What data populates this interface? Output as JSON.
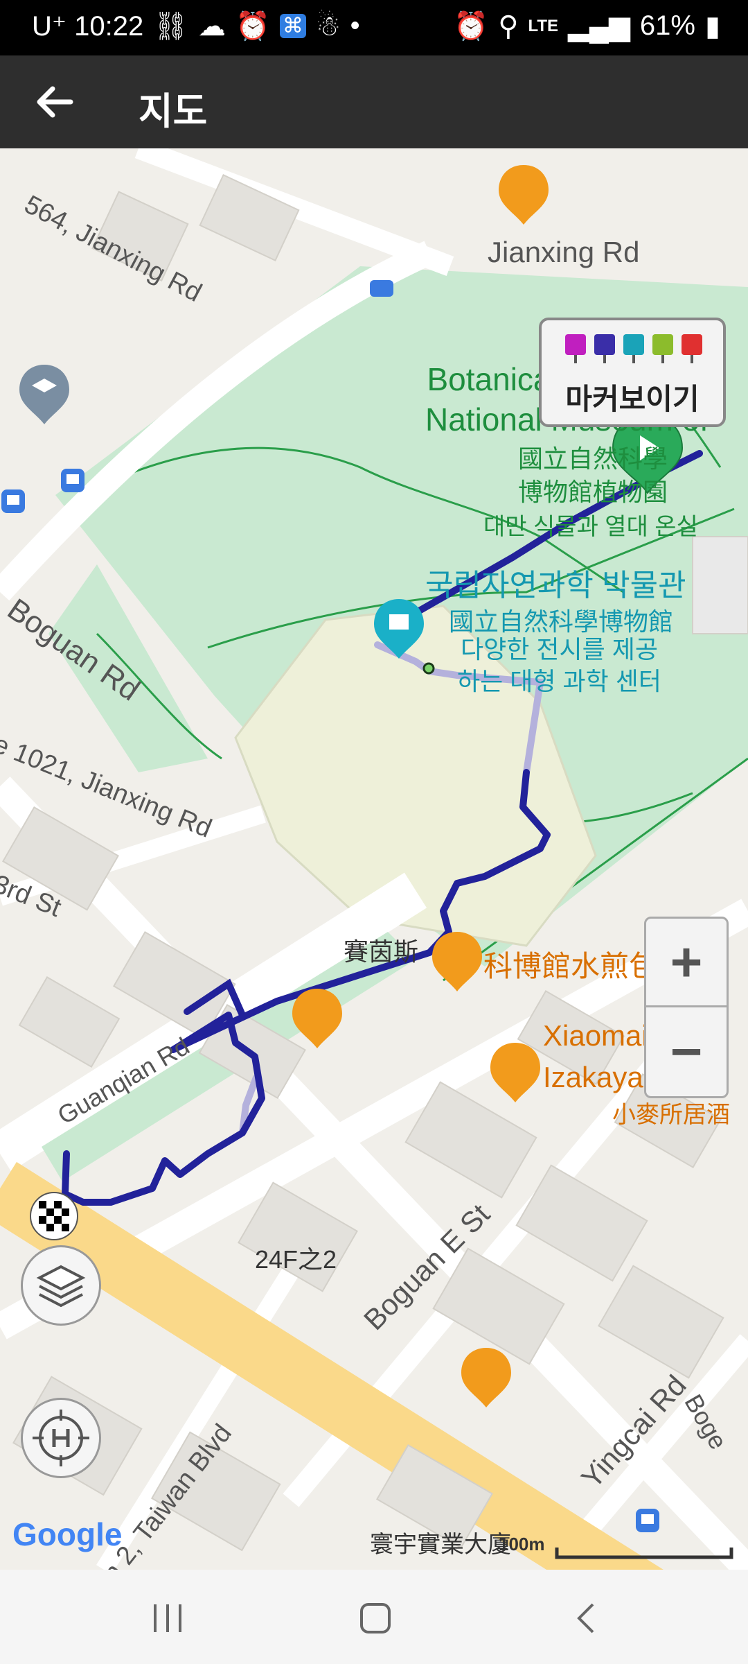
{
  "status_bar": {
    "carrier_time": "U⁺ 10:22",
    "network": "LTE",
    "battery": "61%"
  },
  "app_bar": {
    "title": "지도"
  },
  "marker_panel": {
    "label": "마커보이기",
    "icon_colors": [
      "#c01fbf",
      "#3a2ea8",
      "#1aa3b8",
      "#8cbc2c",
      "#e03030"
    ]
  },
  "map_labels": {
    "road_jianxing_top": "564, Jianxing Rd",
    "road_jianxing_right": "Jianxing Rd",
    "garden_en": "Botanical Garden of\nNational Museum of",
    "garden_zh": "國立自然科學\n博物館植物園",
    "garden_ko": "대만 식물과 열대 온실",
    "museum_ko": "국립자연과학 박물관",
    "museum_zh": "國立自然科學博物館",
    "museum_desc": "다양한 전시를 제공\n하는 대형 과학 센터",
    "boguan_rd": "Boguan Rd",
    "lane_1021": "e 1021, Jianxing Rd",
    "third_st": "3rd St",
    "saiyinsi": "賽茵斯",
    "restaurant_1": "科博館水煎包",
    "restaurant_2": "Xiaomai S\nIzakaya Resta",
    "restaurant_2_zh": "小麥所居酒",
    "guanqian_rd": "Guanqian Rd",
    "boguan_e_st": "Boguan E St",
    "floor_24": "24F之2",
    "taiwan_blvd": "n 2, Taiwan Blvd",
    "yingcai_rd": "Yingcai Rd",
    "bog_right": "Boge",
    "huanyu": "寰宇實業大廈",
    "scale": "100m",
    "google": "Google"
  },
  "zoom": {
    "in": "+",
    "out": "−"
  }
}
